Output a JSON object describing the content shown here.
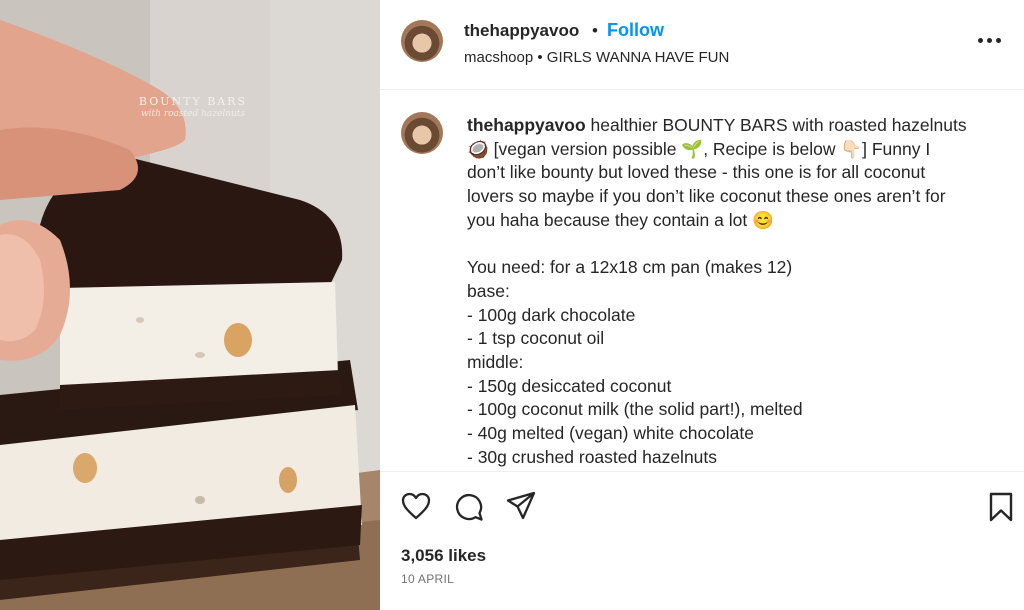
{
  "photo": {
    "title": "BOUNTY BARS",
    "subtitle": "with roasted hazelnuts"
  },
  "header": {
    "username": "thehappyavoo",
    "separator": "•",
    "follow_label": "Follow",
    "subline": "macshoop • GIRLS WANNA HAVE FUN"
  },
  "caption": {
    "username": "thehappyavoo",
    "text": " healthier BOUNTY BARS with roasted hazelnuts\n🥥 [vegan version possible 🌱, Recipe is below 👇🏻] Funny I\ndon’t like bounty but loved these - this one is for all coconut\nlovers so maybe if you don’t like coconut these ones aren’t for\nyou haha because they contain a lot 😊\n\nYou need: for a 12x18 cm pan (makes 12)\nbase:\n- 100g dark chocolate\n- 1 tsp coconut oil\nmiddle:\n- 150g desiccated coconut\n- 100g coconut milk (the solid part!), melted\n- 40g melted (vegan) white chocolate\n- 30g crushed roasted hazelnuts"
  },
  "footer": {
    "likes": "3,056 likes",
    "date": "10 APRIL"
  }
}
